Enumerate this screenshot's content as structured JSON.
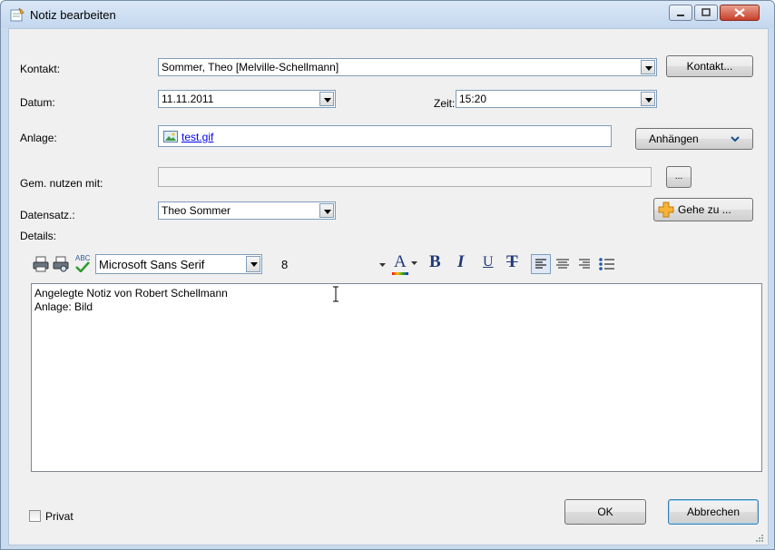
{
  "window": {
    "title": "Notiz bearbeiten"
  },
  "form": {
    "kontakt_label": "Kontakt:",
    "kontakt_value": "Sommer, Theo [Melville-Schellmann]",
    "kontakt_button": "Kontakt...",
    "datum_label": "Datum:",
    "datum_value": "11.11.2011",
    "zeit_label": "Zeit:",
    "zeit_value": "15:20",
    "anlage_label": "Anlage:",
    "anlage_file": "test.gif",
    "anhaengen_button": "Anhängen",
    "gem_label": "Gem. nutzen mit:",
    "gem_value": "",
    "gem_button": "...",
    "datensatz_label": "Datensatz.:",
    "datensatz_value": "Theo Sommer",
    "gehezu_button": "Gehe zu ...",
    "details_label": "Details:"
  },
  "toolbar": {
    "font_name": "Microsoft Sans Serif",
    "font_size": "8",
    "spell_abc": "ABC",
    "font_color_glyph": "A",
    "bold_glyph": "B",
    "italic_glyph": "I",
    "underline_glyph": "U",
    "strike_glyph": "T"
  },
  "editor": {
    "line1": "Angelegte Notiz von Robert Schellmann",
    "line2": "Anlage: Bild"
  },
  "footer": {
    "privat_label": "Privat",
    "privat_checked": false,
    "ok_button": "OK",
    "cancel_button": "Abbrechen"
  },
  "colors": {
    "accent": "#3c7fb1",
    "link": "#0000ee",
    "close": "#c7402a"
  }
}
